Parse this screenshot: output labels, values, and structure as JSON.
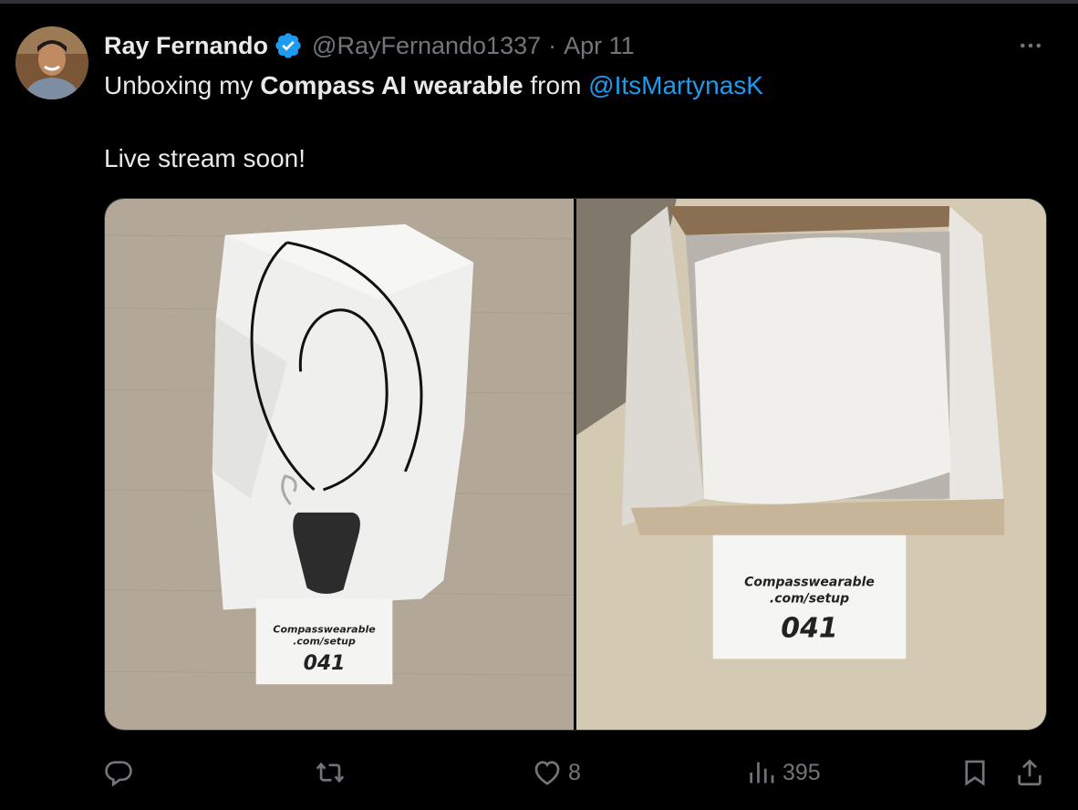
{
  "tweet": {
    "author": {
      "display_name": "Ray Fernando",
      "handle": "@RayFernando1337",
      "verified": true,
      "avatar_icon": "profile-avatar"
    },
    "separator": "·",
    "date": "Apr 11",
    "text": {
      "prefix": "Unboxing my ",
      "bold": "Compass AI wearable",
      "middle": " from ",
      "mention": "@ItsMartynasK",
      "line2": "Live stream soon!"
    },
    "media": [
      {
        "description": "Black pendant on cord over white tissue paper on beige fabric",
        "card_lines": [
          "Compasswearable",
          ".com/setup"
        ],
        "card_number": "041"
      },
      {
        "description": "Open white box with tissue-wrapped item on marble surface",
        "card_lines": [
          "Compasswearable",
          ".com/setup"
        ],
        "card_number": "041"
      }
    ],
    "actions": {
      "reply": {
        "icon": "reply-icon",
        "count": ""
      },
      "retweet": {
        "icon": "retweet-icon",
        "count": ""
      },
      "like": {
        "icon": "heart-icon",
        "count": "8"
      },
      "views": {
        "icon": "views-chart-icon",
        "count": "395"
      },
      "bookmark": {
        "icon": "bookmark-icon"
      },
      "share": {
        "icon": "share-icon"
      }
    },
    "colors": {
      "background": "#000000",
      "text": "#e7e9ea",
      "muted": "#71767b",
      "accent": "#1d9bf0"
    }
  }
}
